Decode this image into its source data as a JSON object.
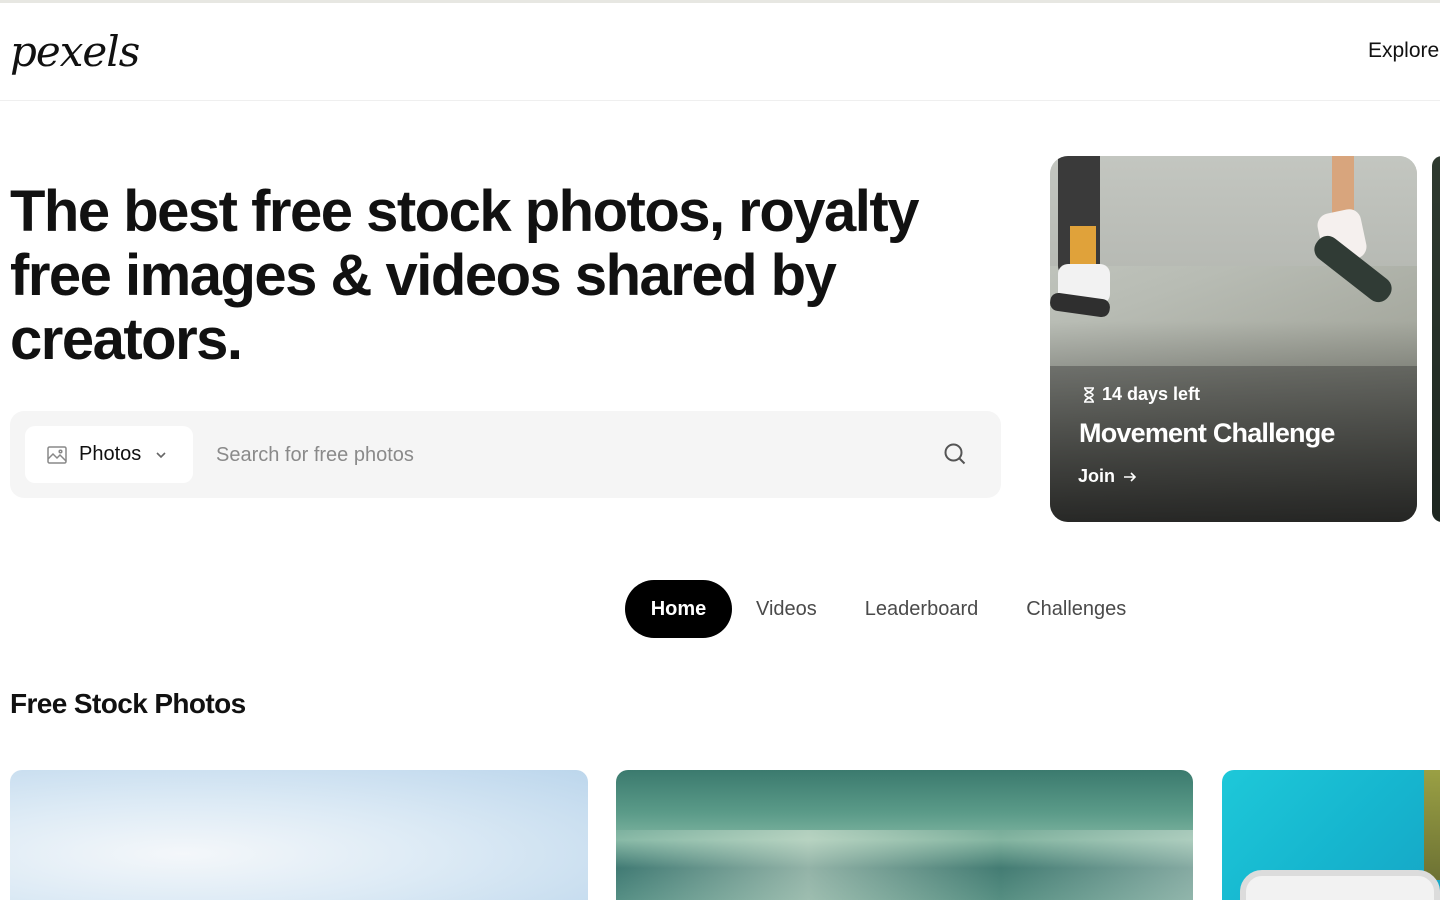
{
  "header": {
    "logo_text": "pexels",
    "nav_explore": "Explore"
  },
  "hero": {
    "title": "The best free stock photos, royalty free images & videos shared by creators."
  },
  "search": {
    "type_label": "Photos",
    "placeholder": "Search for free photos"
  },
  "challenge": {
    "time_left": "14 days left",
    "title": "Movement Challenge",
    "join_label": "Join"
  },
  "tabs": [
    {
      "label": "Home",
      "active": true
    },
    {
      "label": "Videos",
      "active": false
    },
    {
      "label": "Leaderboard",
      "active": false
    },
    {
      "label": "Challenges",
      "active": false
    }
  ],
  "section": {
    "title": "Free Stock Photos"
  },
  "icons": {
    "image": "image-icon",
    "chevron": "chevron-down-icon",
    "search": "search-icon",
    "hourglass": "hourglass-icon",
    "arrow": "arrow-right-icon"
  },
  "colors": {
    "active_tab_bg": "#000000",
    "search_bg": "#f5f5f5",
    "text": "#111111"
  }
}
